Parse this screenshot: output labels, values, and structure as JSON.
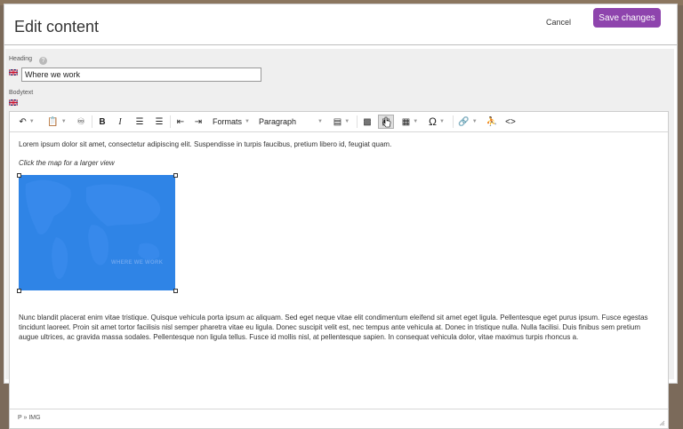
{
  "dialog": {
    "title": "Edit content",
    "cancel_label": "Cancel",
    "save_label": "Save changes"
  },
  "fields": {
    "heading_label": "Heading",
    "heading_value": "Where we work",
    "bodytext_label": "Bodytext"
  },
  "toolbar": {
    "formats_label": "Formats",
    "block_format_label": "Paragraph",
    "items": [
      "undo-icon",
      "paste-icon",
      "find-icon",
      "bold-icon",
      "italic-icon",
      "bullet-list-icon",
      "numbered-list-icon",
      "outdent-icon",
      "indent-icon",
      "align-icon",
      "image-icon",
      "media-icon",
      "table-icon",
      "special-char-icon",
      "link-icon",
      "accessibility-icon",
      "source-code-icon"
    ]
  },
  "content": {
    "paragraph1": "Lorem ipsum dolor sit amet, consectetur adipiscing elit. Suspendisse in turpis faucibus, pretium libero id, feugiat quam.",
    "caption": "Click the map for a larger view",
    "map_label": "WHERE WE WORK",
    "paragraph2": "Nunc blandit placerat enim vitae tristique. Quisque vehicula porta ipsum ac aliquam. Sed eget neque vitae elit condimentum eleifend sit amet eget ligula. Pellentesque eget purus ipsum. Fusce egestas tincidunt laoreet. Proin sit amet tortor facilisis nisl semper pharetra vitae eu ligula. Donec suscipit velit est, nec tempus ante vehicula at. Donec in tristique nulla. Nulla facilisi. Duis finibus sem pretium augue ultrices, ac gravida massa sodales. Pellentesque non ligula tellus. Fusce id mollis nisl, at pellentesque sapien. In consequat vehicula dolor, vitae maximus turpis rhoncus a."
  },
  "statusbar": {
    "path": "P » IMG"
  },
  "colors": {
    "accent": "#8e44ad",
    "map": "#2f84e6"
  }
}
